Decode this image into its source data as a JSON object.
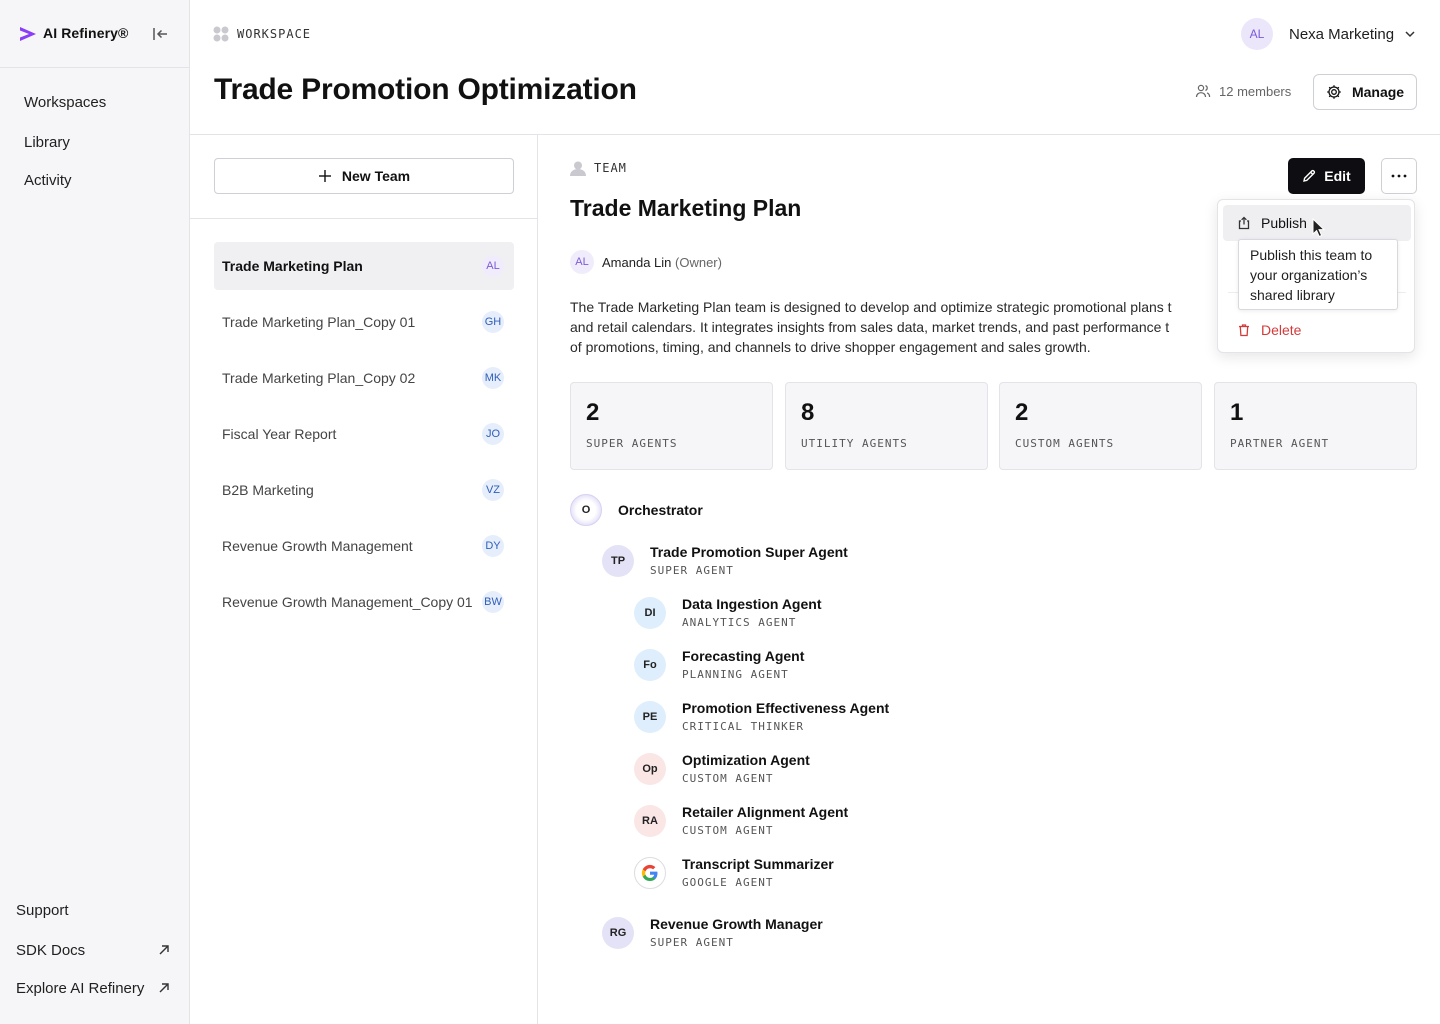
{
  "sidebar": {
    "brand": "AI Refinery®",
    "nav": [
      "Workspaces",
      "Library",
      "Activity"
    ],
    "footer": {
      "support": "Support",
      "sdk_docs": "SDK Docs",
      "explore": "Explore AI Refinery"
    }
  },
  "header": {
    "workspace_label": "WORKSPACE",
    "title": "Trade Promotion Optimization",
    "org_initials": "AL",
    "org_name": "Nexa Marketing",
    "members": "12 members",
    "manage": "Manage"
  },
  "teams": {
    "new_team": "New Team",
    "items": [
      {
        "label": "Trade Marketing Plan",
        "initials": "AL",
        "active": true
      },
      {
        "label": "Trade Marketing Plan_Copy 01",
        "initials": "GH"
      },
      {
        "label": "Trade Marketing Plan_Copy 02",
        "initials": "MK"
      },
      {
        "label": "Fiscal Year Report",
        "initials": "JO"
      },
      {
        "label": "B2B Marketing",
        "initials": "VZ"
      },
      {
        "label": "Revenue Growth Management",
        "initials": "DY"
      },
      {
        "label": "Revenue Growth Management_Copy 01",
        "initials": "BW"
      }
    ]
  },
  "detail": {
    "tag": "TEAM",
    "title": "Trade Marketing Plan",
    "owner_initials": "AL",
    "owner_name": "Amanda Lin",
    "owner_role": "(Owner)",
    "description_lines": [
      "The Trade Marketing Plan team is designed to develop and optimize strategic promotional plans t",
      "and retail calendars. It integrates insights from sales data, market trends, and past performance t",
      "of promotions, timing, and channels to drive shopper engagement and sales growth."
    ],
    "edit": "Edit",
    "stats": [
      {
        "num": "2",
        "cap": "SUPER AGENTS"
      },
      {
        "num": "8",
        "cap": "UTILITY AGENTS"
      },
      {
        "num": "2",
        "cap": "CUSTOM AGENTS"
      },
      {
        "num": "1",
        "cap": "PARTNER AGENT"
      }
    ],
    "tree": {
      "orchestrator": {
        "initials": "O",
        "name": "Orchestrator"
      },
      "super1": {
        "initials": "TP",
        "name": "Trade Promotion Super Agent",
        "type": "SUPER AGENT"
      },
      "children": [
        {
          "initials": "DI",
          "name": "Data Ingestion Agent",
          "type": "ANALYTICS AGENT"
        },
        {
          "initials": "Fo",
          "name": "Forecasting Agent",
          "type": "PLANNING AGENT"
        },
        {
          "initials": "PE",
          "name": "Promotion Effectiveness Agent",
          "type": "CRITICAL THINKER"
        },
        {
          "initials": "Op",
          "name": "Optimization Agent",
          "type": "CUSTOM AGENT"
        },
        {
          "initials": "RA",
          "name": "Retailer Alignment Agent",
          "type": "CUSTOM AGENT"
        },
        {
          "initials": "",
          "name": "Transcript Summarizer",
          "type": "GOOGLE AGENT"
        }
      ],
      "super2": {
        "initials": "RG",
        "name": "Revenue Growth Manager",
        "type": "SUPER AGENT"
      }
    }
  },
  "menu": {
    "publish": "Publish",
    "delete": "Delete",
    "tooltip": "Publish this team to your organization’s shared library"
  },
  "colors": {
    "accent_purple": "#7b5ad8",
    "danger": "#d33b3b",
    "primary_button": "#0e0e12"
  }
}
